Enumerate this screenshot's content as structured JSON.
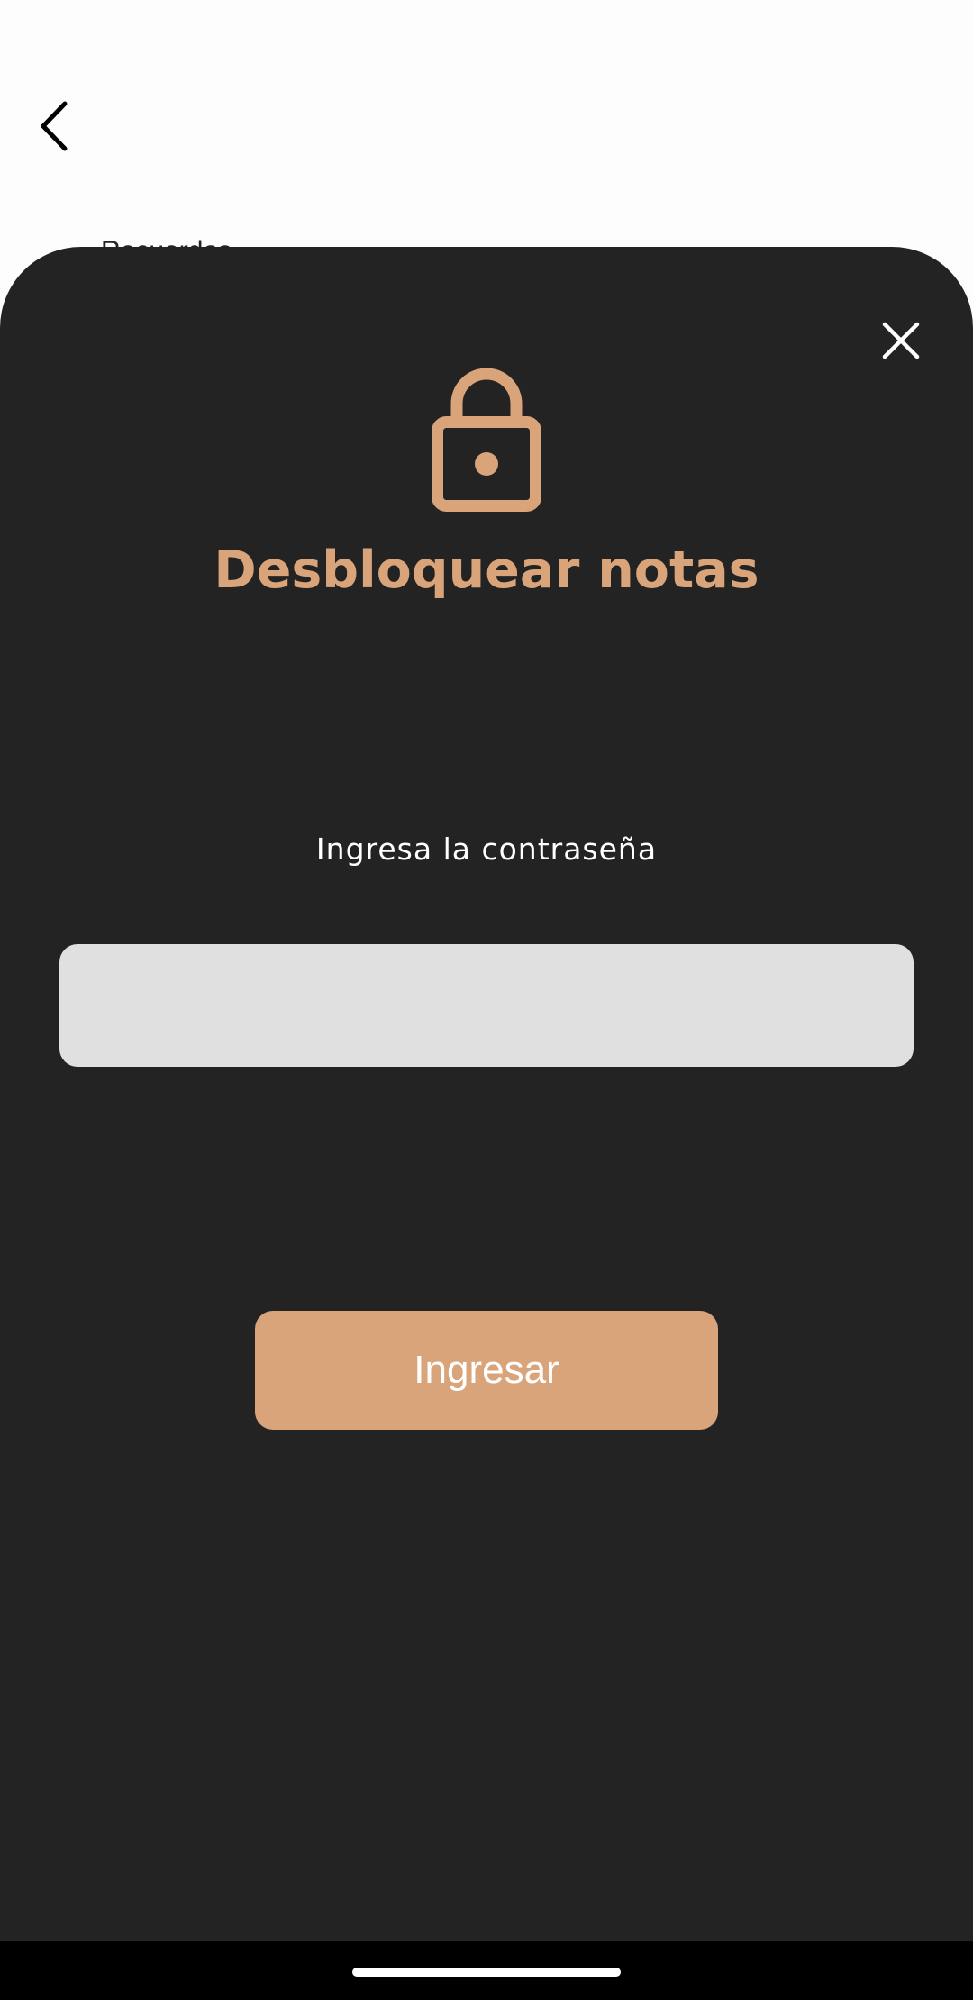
{
  "header": {
    "back_icon": "chevron-left-icon",
    "peek_title": "Recuerdos"
  },
  "dialog": {
    "close_icon": "close-icon",
    "lock_icon": "lock-icon",
    "title": "Desbloquear notas",
    "prompt": "Ingresa la contraseña",
    "password_value": "",
    "password_placeholder": "",
    "submit_label": "Ingresar"
  },
  "colors": {
    "accent": "#d9a47a",
    "sheet_background": "#232323",
    "input_background": "#e0e0e0",
    "page_background": "#fdfdfd"
  }
}
